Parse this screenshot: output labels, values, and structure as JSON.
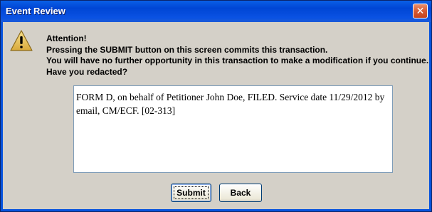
{
  "window": {
    "title": "Event Review",
    "close_symbol": "✕"
  },
  "icon": "warning-icon",
  "message": {
    "line1": "Attention!",
    "line2": "Pressing the SUBMIT button on this screen commits this transaction.",
    "line3": "You will have no further opportunity in this transaction to make a modification if you continue.",
    "line4": "Have you redacted?"
  },
  "docket_text": "FORM D, on behalf of Petitioner John Doe, FILED. Service date 11/29/2012 by email, CM/ECF. [02-313]",
  "buttons": {
    "submit": "Submit",
    "back": "Back"
  }
}
